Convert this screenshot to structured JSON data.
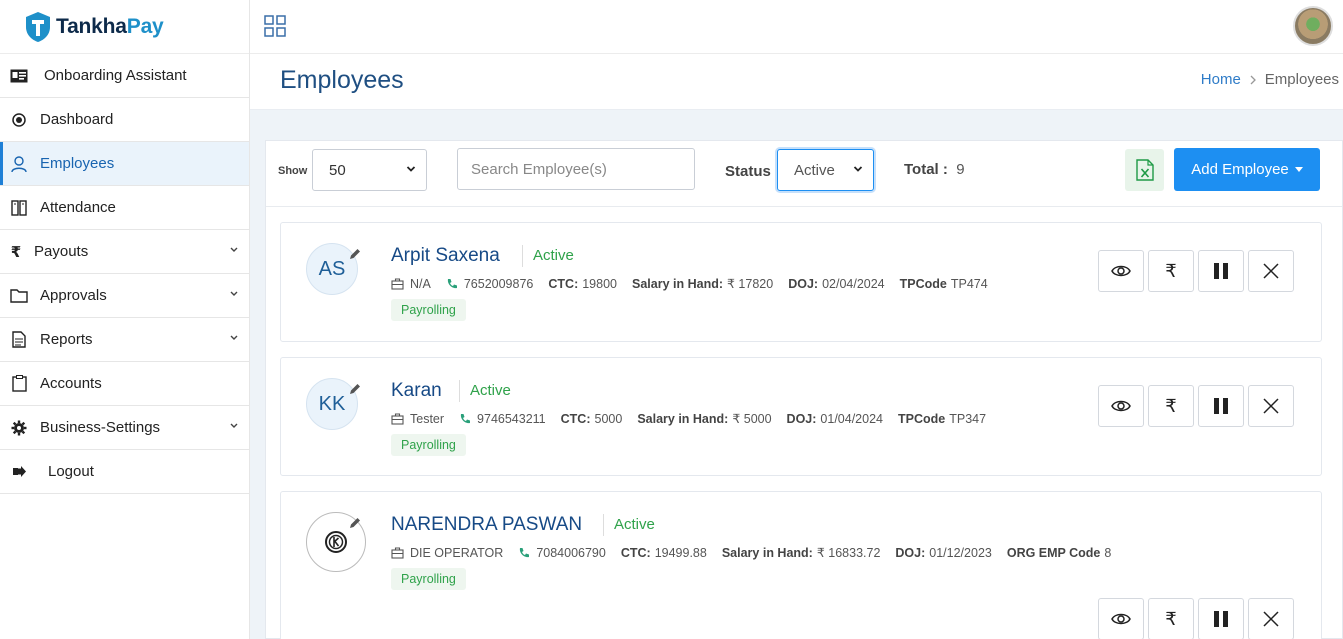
{
  "app": {
    "logo_part1": "Tankha",
    "logo_part2": "Pay"
  },
  "sidebar": {
    "items": [
      {
        "label": "Onboarding Assistant",
        "icon": "id-card-icon"
      },
      {
        "label": "Dashboard",
        "icon": "target-icon"
      },
      {
        "label": "Employees",
        "icon": "user-icon"
      },
      {
        "label": "Attendance",
        "icon": "book-icon"
      },
      {
        "label": "Payouts",
        "icon": "rupee-icon"
      },
      {
        "label": "Approvals",
        "icon": "folder-icon"
      },
      {
        "label": "Reports",
        "icon": "document-icon"
      },
      {
        "label": "Accounts",
        "icon": "clipboard-icon"
      },
      {
        "label": "Business-Settings",
        "icon": "gear-icon"
      },
      {
        "label": "Logout",
        "icon": "logout-icon"
      }
    ]
  },
  "header": {
    "title": "Employees",
    "breadcrumb_home": "Home",
    "breadcrumb_current": "Employees"
  },
  "toolbar": {
    "show_label": "Show",
    "show_value": "50",
    "search_placeholder": "Search Employee(s)",
    "status_label": "Status",
    "status_value": "Active",
    "total_label": "Total :",
    "total_value": "9",
    "add_button": "Add Employee"
  },
  "employees": [
    {
      "initials": "AS",
      "name": "Arpit Saxena",
      "status": "Active",
      "designation": "N/A",
      "phone": "7652009876",
      "ctc_label": "CTC:",
      "ctc": "19800",
      "salary_label": "Salary in Hand:",
      "salary": "₹ 17820",
      "doj_label": "DOJ:",
      "doj": "02/04/2024",
      "code_label": "TPCode",
      "code": "TP474",
      "tag": "Payrolling"
    },
    {
      "initials": "KK",
      "name": "Karan",
      "status": "Active",
      "designation": "Tester",
      "phone": "9746543211",
      "ctc_label": "CTC:",
      "ctc": "5000",
      "salary_label": "Salary in Hand:",
      "salary": "₹ 5000",
      "doj_label": "DOJ:",
      "doj": "01/04/2024",
      "code_label": "TPCode",
      "code": "TP347",
      "tag": "Payrolling"
    },
    {
      "initials": "",
      "name": "NARENDRA PASWAN",
      "status": "Active",
      "designation": "DIE OPERATOR",
      "phone": "7084006790",
      "ctc_label": "CTC:",
      "ctc": "19499.88",
      "salary_label": "Salary in Hand:",
      "salary": "₹ 16833.72",
      "doj_label": "DOJ:",
      "doj": "01/12/2023",
      "code_label": "ORG EMP Code",
      "code": "8",
      "tag": "Payrolling"
    }
  ],
  "action_icons": [
    "eye-icon",
    "rupee-icon",
    "pause-icon",
    "close-icon"
  ],
  "colors": {
    "brand_blue": "#1d8ff2",
    "active_green": "#2fa24a",
    "title_blue": "#1f4f82"
  }
}
